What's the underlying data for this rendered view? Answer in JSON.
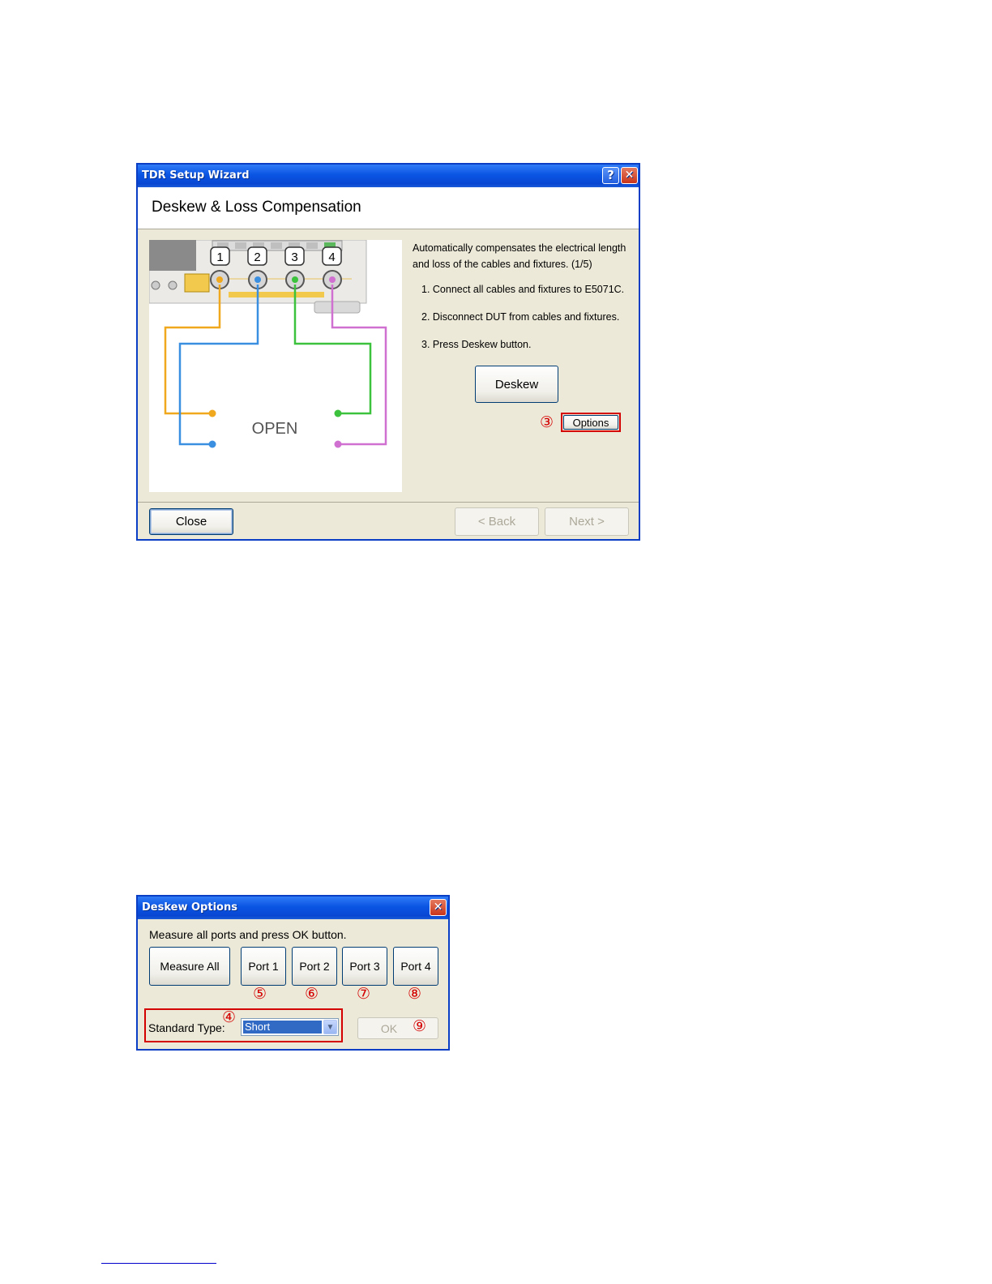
{
  "wizard": {
    "title": "TDR Setup Wizard",
    "help_glyph": "?",
    "close_glyph": "✕",
    "heading": "Deskew & Loss Compensation",
    "description": "Automatically compensates the electrical length and loss of the cables and fixtures.  (1/5)",
    "steps": [
      "1. Connect all cables and fixtures to E5071C.",
      "2. Disconnect DUT from cables and fixtures.",
      "3. Press Deskew button."
    ],
    "deskew_label": "Deskew",
    "options_marker": "③",
    "options_label": "Options",
    "close_label": "Close",
    "back_label": "< Back",
    "next_label": "Next >",
    "diagram": {
      "ports": [
        "1",
        "2",
        "3",
        "4"
      ],
      "label": "OPEN",
      "port_colors": [
        "#f0a81e",
        "#3a8fe0",
        "#3cc23c",
        "#d070d0"
      ]
    }
  },
  "options": {
    "title": "Deskew Options",
    "close_glyph": "✕",
    "instruction": "Measure all ports and press OK button.",
    "measure_all_label": "Measure All",
    "ports": [
      {
        "label": "Port 1",
        "marker": "⑤"
      },
      {
        "label": "Port 2",
        "marker": "⑥"
      },
      {
        "label": "Port 3",
        "marker": "⑦"
      },
      {
        "label": "Port 4",
        "marker": "⑧"
      }
    ],
    "standard_type_label": "Standard Type:",
    "standard_type_marker": "④",
    "standard_type_value": "Short",
    "dropdown_glyph": "▼",
    "ok_label": "OK",
    "ok_marker": "⑨"
  }
}
